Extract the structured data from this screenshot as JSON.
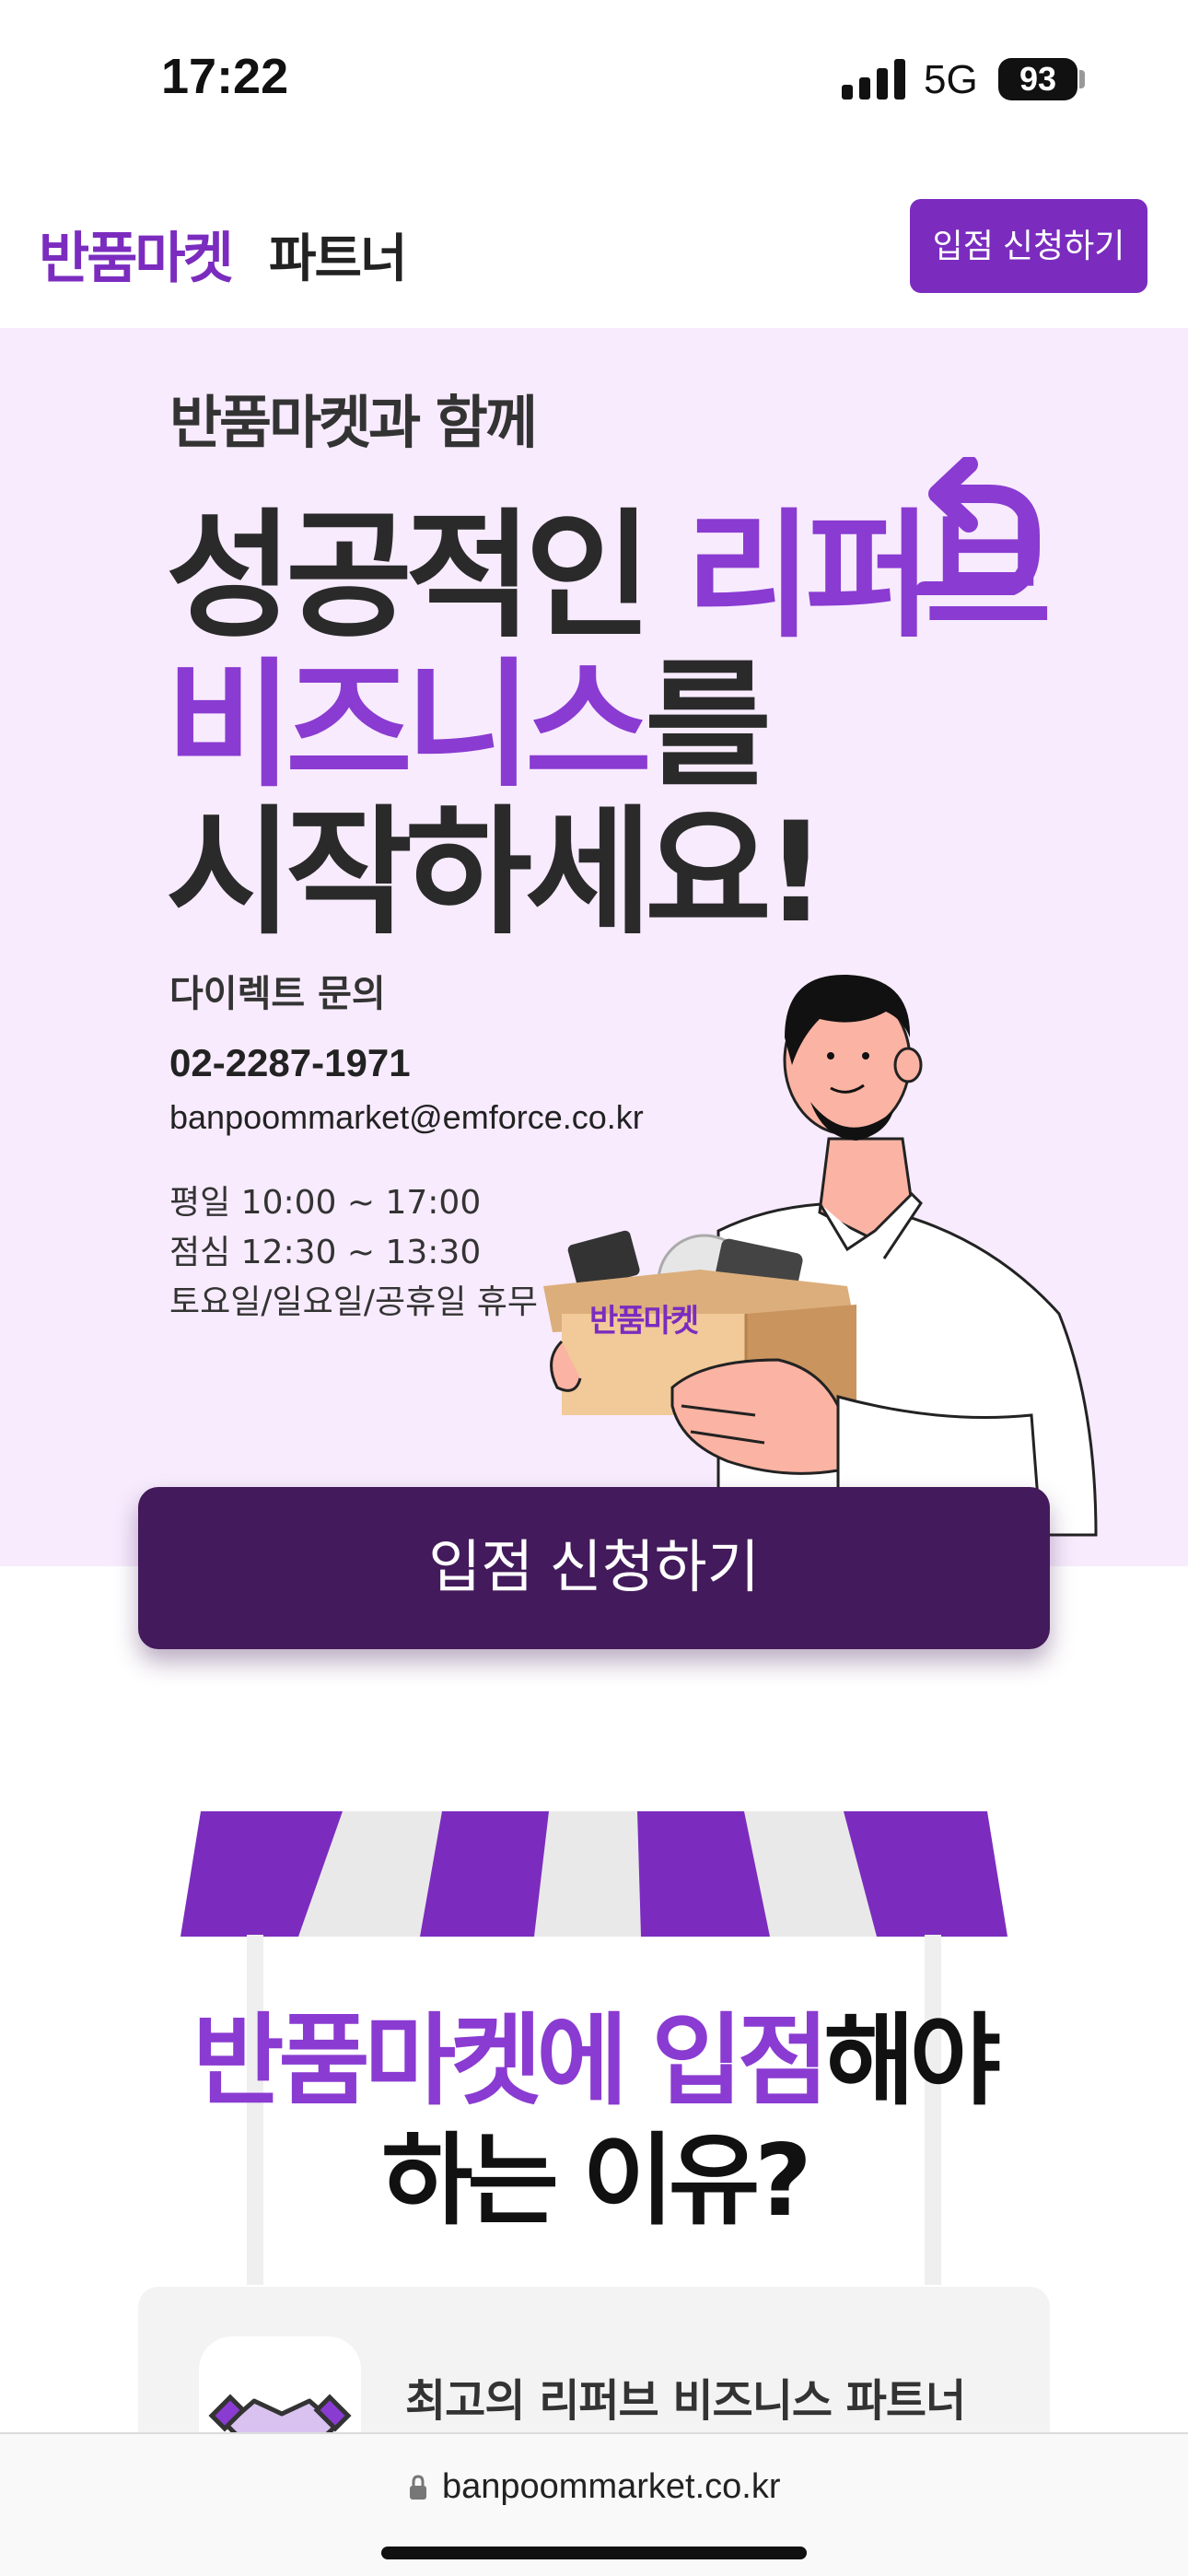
{
  "status_bar": {
    "time": "17:22",
    "network": "5G",
    "battery": "93"
  },
  "header": {
    "logo": "반품마켓",
    "logo_sub": "파트너",
    "apply_button": "입점 신청하기"
  },
  "hero": {
    "eyebrow": "반품마켓과 함께",
    "line1_plain": "성공적인 ",
    "line1_accent": "리퍼브",
    "line2_accent": "비즈니스",
    "line2_plain": "를",
    "line3": "시작하세요!",
    "contact": {
      "title": "다이렉트 문의",
      "phone": "02-2287-1971",
      "email": "banpoommarket@emforce.co.kr"
    },
    "hours": {
      "weekday": "평일  10:00 ~ 17:00",
      "lunch": "점심  12:30 ~ 13:30",
      "closed": "토요일/일요일/공휴일 휴무"
    },
    "box_label": "반품마켓"
  },
  "cta": {
    "label": "입점 신청하기"
  },
  "reasons": {
    "title_accent1": "반품마켓에 ",
    "title_accent2": "입점",
    "title_plain1": "해야",
    "title_line2": "하는 이유?",
    "card1_title": "최고의 리퍼브 비즈니스 파트너"
  },
  "browser": {
    "url": "banpoommarket.co.kr"
  },
  "colors": {
    "brand": "#7b2cbf",
    "accent": "#8a3bd1",
    "cta_dark": "#431a5b",
    "hero_bg": "#f7ebfd"
  }
}
